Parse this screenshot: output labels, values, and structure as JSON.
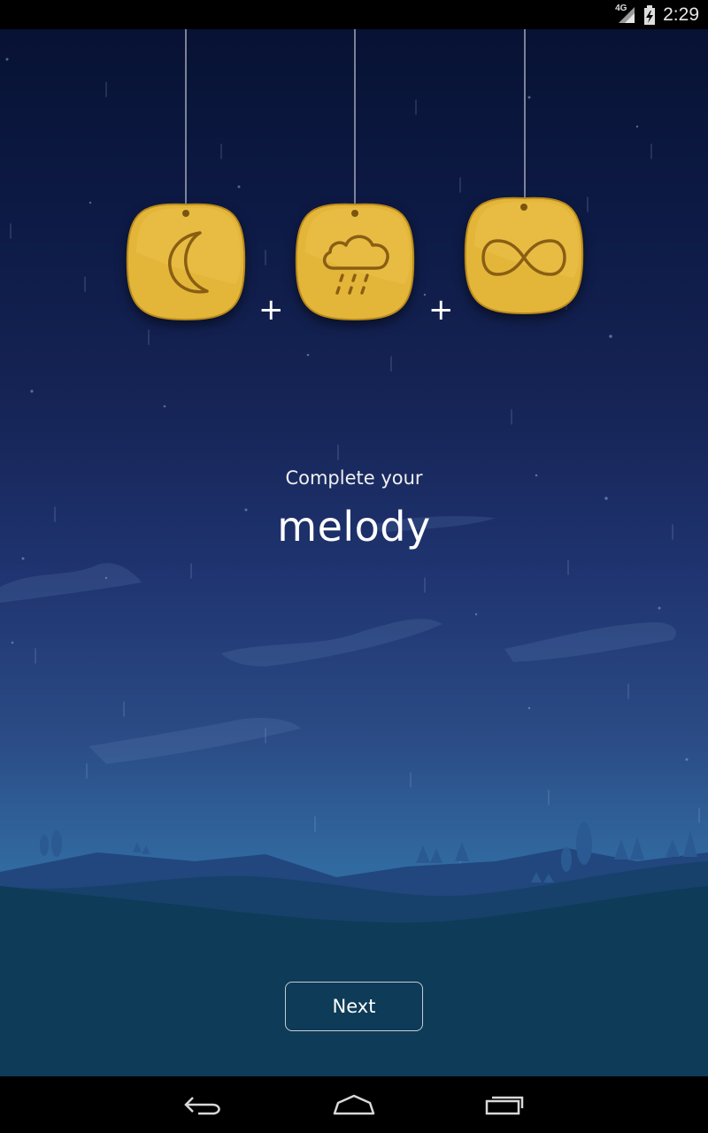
{
  "status_bar": {
    "network": "4G",
    "time": "2:29",
    "icons": [
      "signal-icon",
      "battery-charging-icon"
    ]
  },
  "tags": [
    {
      "icon": "moon-icon"
    },
    {
      "icon": "rain-cloud-icon"
    },
    {
      "icon": "infinity-icon"
    }
  ],
  "separator": "+",
  "main": {
    "subtitle": "Complete your",
    "title": "melody"
  },
  "next_label": "Next",
  "nav_bar": {
    "icons": [
      "back-icon",
      "home-icon",
      "recents-icon"
    ]
  },
  "colors": {
    "tag_gold": "#E3B63A",
    "tag_engrave": "#8A5E12",
    "sky_top": "#071233",
    "sky_bottom": "#316AA0",
    "ground": "#0A3F59"
  }
}
